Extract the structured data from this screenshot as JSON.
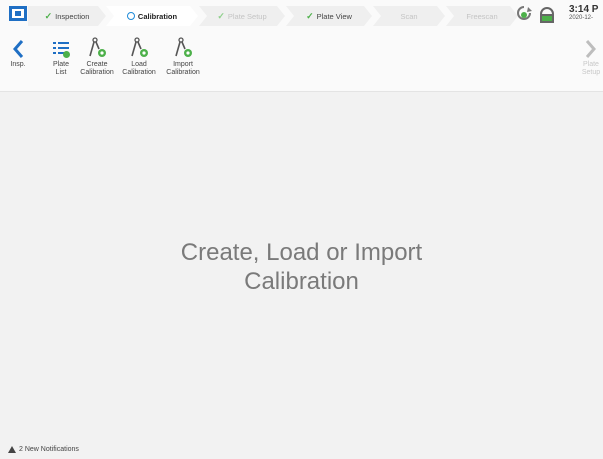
{
  "tabs": [
    {
      "label": "Inspection",
      "state": "done"
    },
    {
      "label": "Calibration",
      "state": "active"
    },
    {
      "label": "Plate Setup",
      "state": "done-dim"
    },
    {
      "label": "Plate View",
      "state": "done"
    },
    {
      "label": "Scan",
      "state": "disabled"
    },
    {
      "label": "Freescan",
      "state": "disabled"
    }
  ],
  "status": {
    "time": "3:14 P",
    "date": "2020-12-"
  },
  "toolbar": {
    "back_label": "Insp.",
    "plate_list_label": "Plate\nList",
    "create_label": "Create\nCalibration",
    "load_label": "Load\nCalibration",
    "import_label": "Import\nCalibration",
    "next_label": "Plate\nSetup"
  },
  "main": {
    "message_line1": "Create, Load or Import",
    "message_line2": "Calibration"
  },
  "footer": {
    "notifications": "2 New Notifications"
  },
  "colors": {
    "accent_blue": "#1f8bd9",
    "accent_green": "#4db04a",
    "nav_blue": "#1f6fc4"
  }
}
